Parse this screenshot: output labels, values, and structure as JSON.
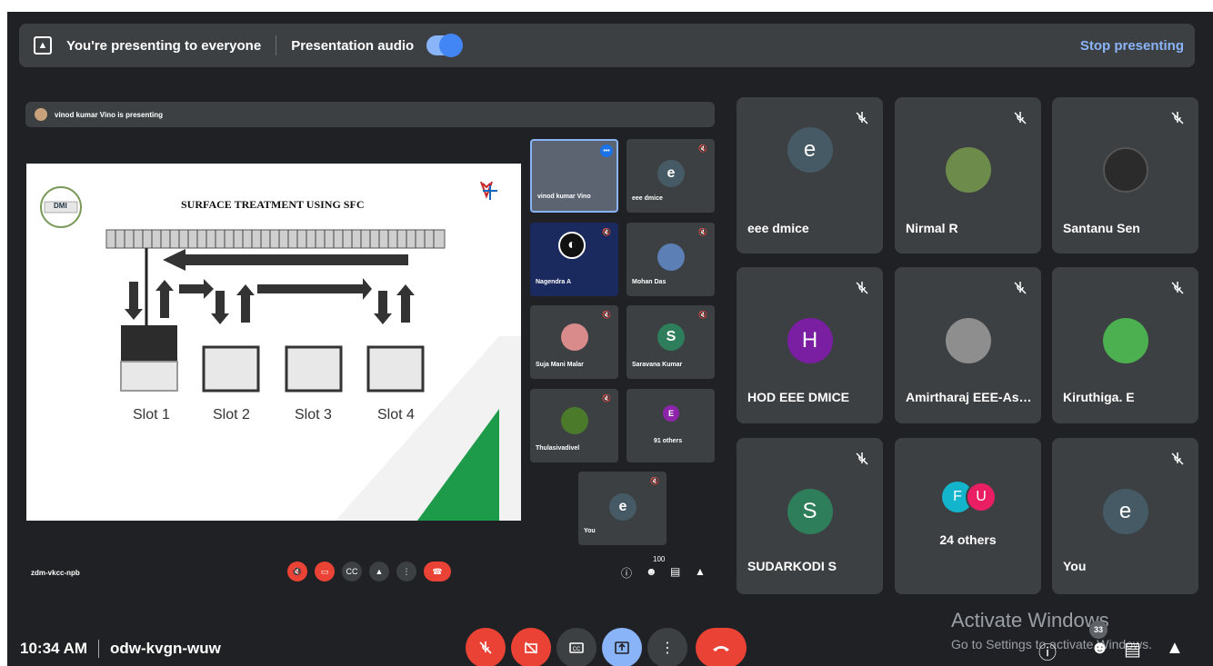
{
  "banner": {
    "presenting_text": "You're presenting to everyone",
    "audio_label": "Presentation audio",
    "stop_label": "Stop presenting"
  },
  "inner": {
    "presenter_text": "vinod kumar Vino is presenting",
    "meeting_code": "zdm-vkcc-npb",
    "people_count": "100",
    "slide": {
      "title": "SURFACE TREATMENT USING SFC",
      "logo_text": "DMI",
      "slots": [
        "Slot 1",
        "Slot 2",
        "Slot 3",
        "Slot 4"
      ]
    },
    "tiles": [
      {
        "name": "vinod kumar Vino"
      },
      {
        "name": "eee dmice",
        "initial": "e"
      },
      {
        "name": "Nagendra A"
      },
      {
        "name": "Mohan Das"
      },
      {
        "name": "Suja Mani Malar"
      },
      {
        "name": "Saravana Kumar",
        "initial": "S"
      },
      {
        "name": "Thulasivadivel"
      },
      {
        "name": "91 others",
        "initial": "E"
      },
      {
        "name": "You",
        "initial": "e"
      }
    ]
  },
  "tiles": [
    {
      "name": "eee dmice",
      "initial": "e",
      "color": "#455a64"
    },
    {
      "name": "Nirmal R",
      "initial": "",
      "color": "#6d8b4a"
    },
    {
      "name": "Santanu Sen",
      "initial": "",
      "color": "#2b2b2b"
    },
    {
      "name": "HOD EEE DMICE",
      "initial": "H",
      "color": "#7b1fa2"
    },
    {
      "name": "Amirtharaj EEE-Ass...",
      "initial": "",
      "color": "#8e8e8e"
    },
    {
      "name": "Kiruthiga. E",
      "initial": "",
      "color": "#4caf50"
    },
    {
      "name": "SUDARKODI S",
      "initial": "S",
      "color": "#2e7d5b"
    },
    {
      "name": "24 others",
      "initial_a": "F",
      "initial_b": "U",
      "color_a": "#12b5cb",
      "color_b": "#e91e63"
    },
    {
      "name": "You",
      "initial": "e",
      "color": "#455a64"
    }
  ],
  "bottom": {
    "time": "10:34 AM",
    "meeting_code": "odw-kvgn-wuw",
    "people_badge": "33"
  },
  "watermark": {
    "line1": "Activate Windows",
    "line2": "Go to Settings to activate Windows."
  }
}
